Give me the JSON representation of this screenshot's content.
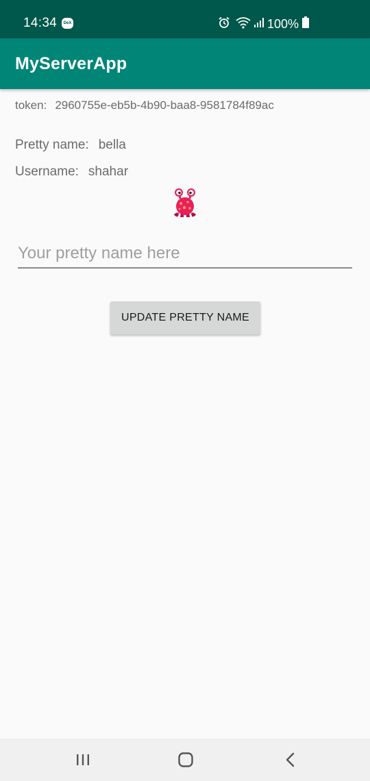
{
  "status_bar": {
    "time": "14:34",
    "dex_label": "DeX",
    "battery": "100%",
    "icons": [
      "dex-icon",
      "alarm-icon",
      "wifi-icon",
      "signal-icon",
      "battery-icon"
    ]
  },
  "app_bar": {
    "title": "MyServerApp"
  },
  "token": {
    "label": "token:",
    "value": "2960755e-eb5b-4b90-baa8-9581784f89ac"
  },
  "profile": {
    "pretty_name_label": "Pretty name:",
    "pretty_name_value": "bella",
    "username_label": "Username:",
    "username_value": "shahar",
    "avatar_icon": "monster-avatar-icon"
  },
  "form": {
    "input_value": "",
    "input_placeholder": "Your pretty name here",
    "update_button_label": "UPDATE PRETTY NAME"
  },
  "nav_bar": {
    "icons": [
      "recents-icon",
      "home-icon",
      "back-icon"
    ]
  },
  "colors": {
    "status_bar": "#00574b",
    "app_bar": "#008577",
    "background": "#fafafa",
    "button": "#d6d7d7",
    "monster": "#e8215a"
  }
}
